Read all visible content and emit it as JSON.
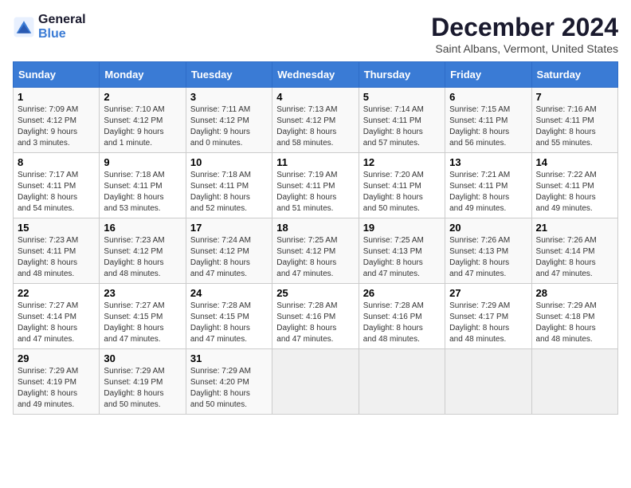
{
  "header": {
    "logo_line1": "General",
    "logo_line2": "Blue",
    "title": "December 2024",
    "subtitle": "Saint Albans, Vermont, United States"
  },
  "columns": [
    "Sunday",
    "Monday",
    "Tuesday",
    "Wednesday",
    "Thursday",
    "Friday",
    "Saturday"
  ],
  "weeks": [
    [
      {
        "day": "1",
        "info": "Sunrise: 7:09 AM\nSunset: 4:12 PM\nDaylight: 9 hours\nand 3 minutes."
      },
      {
        "day": "2",
        "info": "Sunrise: 7:10 AM\nSunset: 4:12 PM\nDaylight: 9 hours\nand 1 minute."
      },
      {
        "day": "3",
        "info": "Sunrise: 7:11 AM\nSunset: 4:12 PM\nDaylight: 9 hours\nand 0 minutes."
      },
      {
        "day": "4",
        "info": "Sunrise: 7:13 AM\nSunset: 4:12 PM\nDaylight: 8 hours\nand 58 minutes."
      },
      {
        "day": "5",
        "info": "Sunrise: 7:14 AM\nSunset: 4:11 PM\nDaylight: 8 hours\nand 57 minutes."
      },
      {
        "day": "6",
        "info": "Sunrise: 7:15 AM\nSunset: 4:11 PM\nDaylight: 8 hours\nand 56 minutes."
      },
      {
        "day": "7",
        "info": "Sunrise: 7:16 AM\nSunset: 4:11 PM\nDaylight: 8 hours\nand 55 minutes."
      }
    ],
    [
      {
        "day": "8",
        "info": "Sunrise: 7:17 AM\nSunset: 4:11 PM\nDaylight: 8 hours\nand 54 minutes."
      },
      {
        "day": "9",
        "info": "Sunrise: 7:18 AM\nSunset: 4:11 PM\nDaylight: 8 hours\nand 53 minutes."
      },
      {
        "day": "10",
        "info": "Sunrise: 7:18 AM\nSunset: 4:11 PM\nDaylight: 8 hours\nand 52 minutes."
      },
      {
        "day": "11",
        "info": "Sunrise: 7:19 AM\nSunset: 4:11 PM\nDaylight: 8 hours\nand 51 minutes."
      },
      {
        "day": "12",
        "info": "Sunrise: 7:20 AM\nSunset: 4:11 PM\nDaylight: 8 hours\nand 50 minutes."
      },
      {
        "day": "13",
        "info": "Sunrise: 7:21 AM\nSunset: 4:11 PM\nDaylight: 8 hours\nand 49 minutes."
      },
      {
        "day": "14",
        "info": "Sunrise: 7:22 AM\nSunset: 4:11 PM\nDaylight: 8 hours\nand 49 minutes."
      }
    ],
    [
      {
        "day": "15",
        "info": "Sunrise: 7:23 AM\nSunset: 4:11 PM\nDaylight: 8 hours\nand 48 minutes."
      },
      {
        "day": "16",
        "info": "Sunrise: 7:23 AM\nSunset: 4:12 PM\nDaylight: 8 hours\nand 48 minutes."
      },
      {
        "day": "17",
        "info": "Sunrise: 7:24 AM\nSunset: 4:12 PM\nDaylight: 8 hours\nand 47 minutes."
      },
      {
        "day": "18",
        "info": "Sunrise: 7:25 AM\nSunset: 4:12 PM\nDaylight: 8 hours\nand 47 minutes."
      },
      {
        "day": "19",
        "info": "Sunrise: 7:25 AM\nSunset: 4:13 PM\nDaylight: 8 hours\nand 47 minutes."
      },
      {
        "day": "20",
        "info": "Sunrise: 7:26 AM\nSunset: 4:13 PM\nDaylight: 8 hours\nand 47 minutes."
      },
      {
        "day": "21",
        "info": "Sunrise: 7:26 AM\nSunset: 4:14 PM\nDaylight: 8 hours\nand 47 minutes."
      }
    ],
    [
      {
        "day": "22",
        "info": "Sunrise: 7:27 AM\nSunset: 4:14 PM\nDaylight: 8 hours\nand 47 minutes."
      },
      {
        "day": "23",
        "info": "Sunrise: 7:27 AM\nSunset: 4:15 PM\nDaylight: 8 hours\nand 47 minutes."
      },
      {
        "day": "24",
        "info": "Sunrise: 7:28 AM\nSunset: 4:15 PM\nDaylight: 8 hours\nand 47 minutes."
      },
      {
        "day": "25",
        "info": "Sunrise: 7:28 AM\nSunset: 4:16 PM\nDaylight: 8 hours\nand 47 minutes."
      },
      {
        "day": "26",
        "info": "Sunrise: 7:28 AM\nSunset: 4:16 PM\nDaylight: 8 hours\nand 48 minutes."
      },
      {
        "day": "27",
        "info": "Sunrise: 7:29 AM\nSunset: 4:17 PM\nDaylight: 8 hours\nand 48 minutes."
      },
      {
        "day": "28",
        "info": "Sunrise: 7:29 AM\nSunset: 4:18 PM\nDaylight: 8 hours\nand 48 minutes."
      }
    ],
    [
      {
        "day": "29",
        "info": "Sunrise: 7:29 AM\nSunset: 4:19 PM\nDaylight: 8 hours\nand 49 minutes."
      },
      {
        "day": "30",
        "info": "Sunrise: 7:29 AM\nSunset: 4:19 PM\nDaylight: 8 hours\nand 50 minutes."
      },
      {
        "day": "31",
        "info": "Sunrise: 7:29 AM\nSunset: 4:20 PM\nDaylight: 8 hours\nand 50 minutes."
      },
      null,
      null,
      null,
      null
    ]
  ]
}
